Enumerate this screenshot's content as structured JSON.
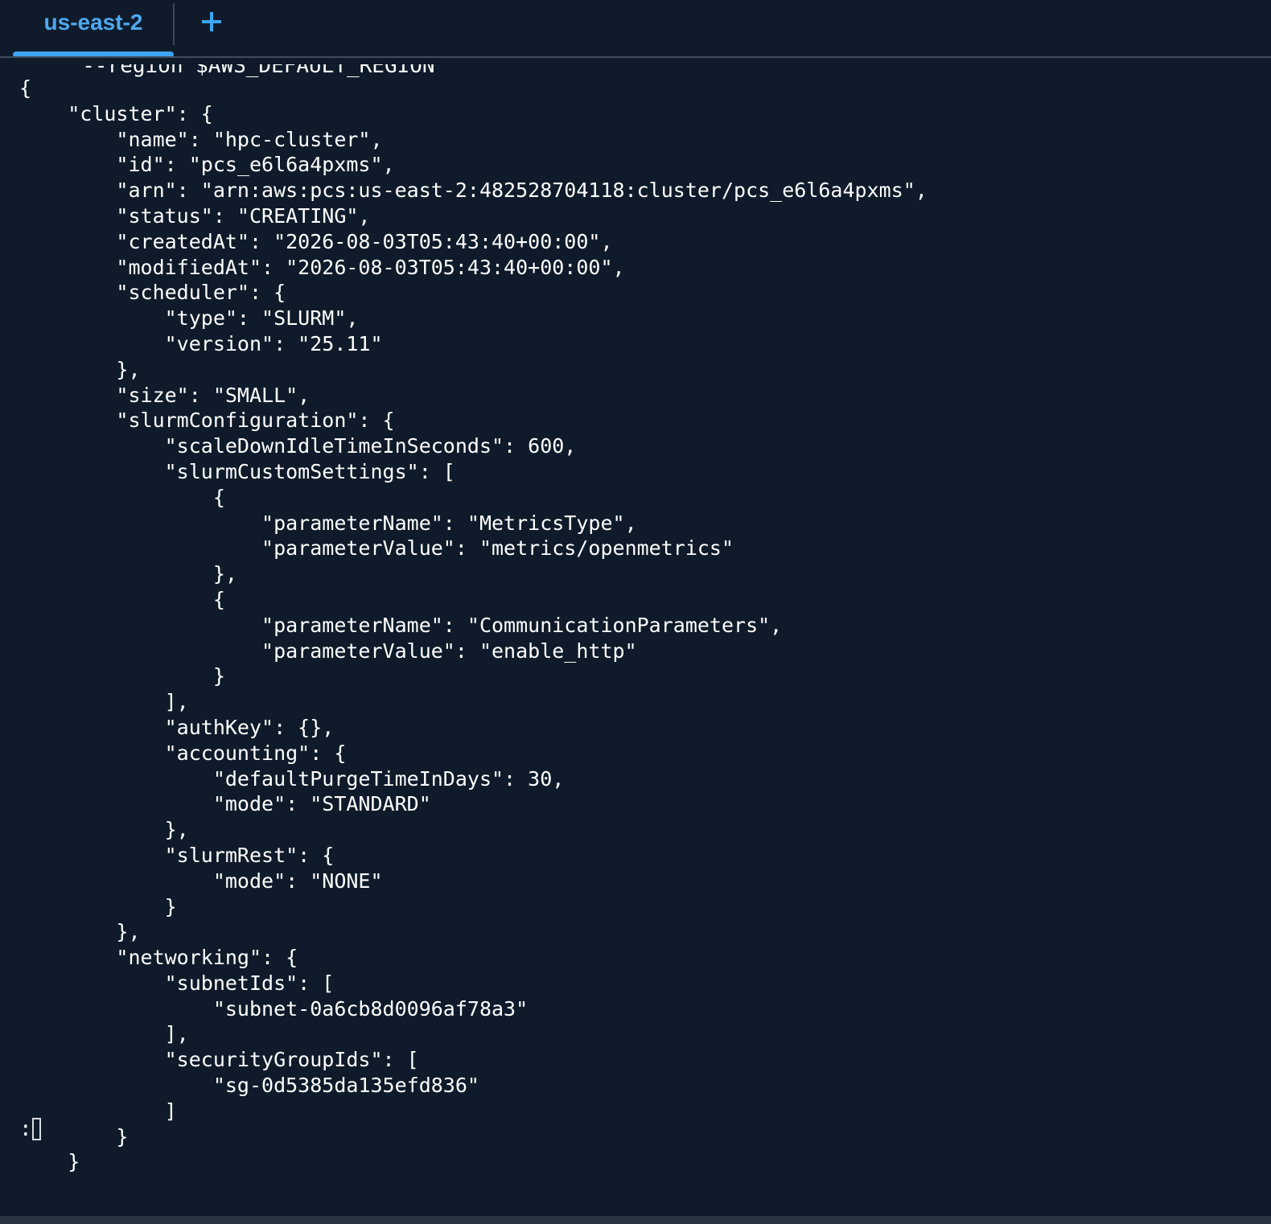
{
  "tabs": {
    "active_label": "us-east-2",
    "add_icon": "plus-icon"
  },
  "terminal": {
    "cutoff_line": "     --region $AWS_DEFAULT_REGION",
    "lines": [
      "{",
      "    \"cluster\": {",
      "        \"name\": \"hpc-cluster\",",
      "        \"id\": \"pcs_e6l6a4pxms\",",
      "        \"arn\": \"arn:aws:pcs:us-east-2:482528704118:cluster/pcs_e6l6a4pxms\",",
      "        \"status\": \"CREATING\",",
      "        \"createdAt\": \"2026-08-03T05:43:40+00:00\",",
      "        \"modifiedAt\": \"2026-08-03T05:43:40+00:00\",",
      "        \"scheduler\": {",
      "            \"type\": \"SLURM\",",
      "            \"version\": \"25.11\"",
      "        },",
      "        \"size\": \"SMALL\",",
      "        \"slurmConfiguration\": {",
      "            \"scaleDownIdleTimeInSeconds\": 600,",
      "            \"slurmCustomSettings\": [",
      "                {",
      "                    \"parameterName\": \"MetricsType\",",
      "                    \"parameterValue\": \"metrics/openmetrics\"",
      "                },",
      "                {",
      "                    \"parameterName\": \"CommunicationParameters\",",
      "                    \"parameterValue\": \"enable_http\"",
      "                }",
      "            ],",
      "            \"authKey\": {},",
      "            \"accounting\": {",
      "                \"defaultPurgeTimeInDays\": 30,",
      "                \"mode\": \"STANDARD\"",
      "            },",
      "            \"slurmRest\": {",
      "                \"mode\": \"NONE\"",
      "            }",
      "        },",
      "        \"networking\": {",
      "            \"subnetIds\": [",
      "                \"subnet-0a6cb8d0096af78a3\"",
      "            ],",
      "            \"securityGroupIds\": [",
      "                \"sg-0d5385da135efd836\"",
      "            ]",
      "        }",
      "    }"
    ],
    "prompt": ":"
  }
}
